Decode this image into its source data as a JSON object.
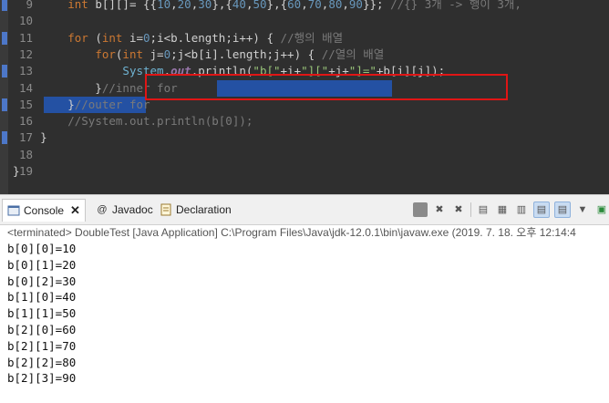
{
  "editor": {
    "lines": [
      {
        "num": "9",
        "parts": [
          [
            "",
            "        "
          ],
          [
            "kw",
            "int"
          ],
          [
            "",
            " b[][]= {{"
          ],
          [
            "num-lit",
            "10"
          ],
          [
            "",
            ","
          ],
          [
            "num-lit",
            "20"
          ],
          [
            "",
            ","
          ],
          [
            "num-lit",
            "30"
          ],
          [
            "",
            "},{"
          ],
          [
            "num-lit",
            "40"
          ],
          [
            "",
            ","
          ],
          [
            "num-lit",
            "50"
          ],
          [
            "",
            "},{"
          ],
          [
            "num-lit",
            "60"
          ],
          [
            "",
            ","
          ],
          [
            "num-lit",
            "70"
          ],
          [
            "",
            ","
          ],
          [
            "num-lit",
            "80"
          ],
          [
            "",
            ","
          ],
          [
            "num-lit",
            "90"
          ],
          [
            "",
            "}}; "
          ],
          [
            "cmt",
            "//{} 3개 -> 행이 3개,"
          ]
        ]
      },
      {
        "num": "10",
        "parts": []
      },
      {
        "num": "11",
        "parts": [
          [
            "",
            "        "
          ],
          [
            "kw",
            "for"
          ],
          [
            "",
            " ("
          ],
          [
            "kw",
            "int"
          ],
          [
            "",
            " i="
          ],
          [
            "num-lit",
            "0"
          ],
          [
            "",
            ";i<b.length;i++) { "
          ],
          [
            "cmt",
            "//행의 배열"
          ]
        ]
      },
      {
        "num": "12",
        "parts": [
          [
            "",
            "            "
          ],
          [
            "kw",
            "for"
          ],
          [
            "",
            "("
          ],
          [
            "kw",
            "int"
          ],
          [
            "",
            " j="
          ],
          [
            "num-lit",
            "0"
          ],
          [
            "",
            ";j<b[i].length;j++) { "
          ],
          [
            "cmt",
            "//열의 배열"
          ]
        ]
      },
      {
        "num": "13",
        "parts": [
          [
            "",
            "                "
          ],
          [
            "cls",
            "System"
          ],
          [
            "",
            "."
          ],
          [
            "field",
            "out"
          ],
          [
            "",
            ".println("
          ],
          [
            "str",
            "\"b[\""
          ],
          [
            "",
            "+i+"
          ],
          [
            "str",
            "\"][\""
          ],
          [
            "",
            "+j+"
          ],
          [
            "str",
            "\"]=\""
          ],
          [
            "",
            "+b[i][j]);"
          ]
        ]
      },
      {
        "num": "14",
        "parts": [
          [
            "",
            "            }"
          ],
          [
            "cmt",
            "//inner for"
          ]
        ]
      },
      {
        "num": "15",
        "parts": [
          [
            "",
            "        }"
          ],
          [
            "cmt",
            "//outer for"
          ]
        ]
      },
      {
        "num": "16",
        "parts": [
          [
            "",
            "        "
          ],
          [
            "cmt",
            "//System.out.println(b[0]);"
          ]
        ]
      },
      {
        "num": "17",
        "parts": [
          [
            "",
            "    }"
          ]
        ]
      },
      {
        "num": "18",
        "parts": []
      },
      {
        "num": "19",
        "parts": [
          [
            "",
            "}"
          ]
        ]
      }
    ]
  },
  "tabs": {
    "console": "Console",
    "javadoc": "Javadoc",
    "declaration": "Declaration"
  },
  "status": "<terminated> DoubleTest [Java Application] C:\\Program Files\\Java\\jdk-12.0.1\\bin\\javaw.exe (2019. 7. 18. 오후 12:14:4",
  "output": [
    "b[0][0]=10",
    "b[0][1]=20",
    "b[0][2]=30",
    "b[1][0]=40",
    "b[1][1]=50",
    "b[2][0]=60",
    "b[2][1]=70",
    "b[2][2]=80",
    "b[2][3]=90"
  ],
  "colors": {
    "editor_bg": "#2f2f2f",
    "selection": "#2451a3",
    "highlight_box": "#e01515"
  }
}
